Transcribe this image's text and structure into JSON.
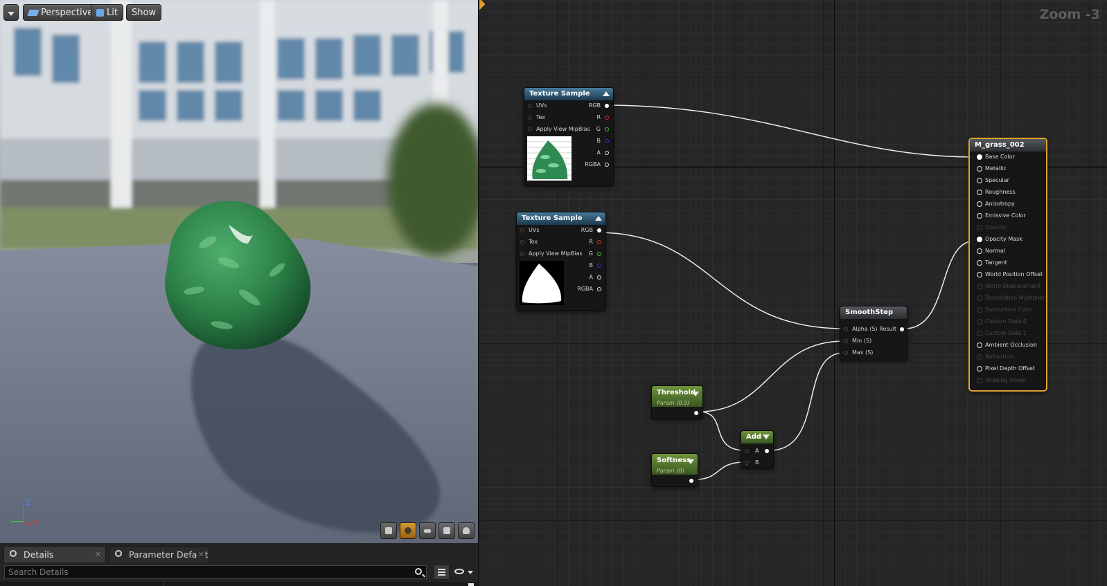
{
  "toolbar": {
    "perspective_label": "Perspective",
    "lit_label": "Lit",
    "show_label": "Show"
  },
  "gizmo": {
    "z": "Z",
    "x": "X"
  },
  "bottom_panel": {
    "tabs": [
      {
        "label": "Details"
      },
      {
        "label": "Parameter Defaults"
      }
    ],
    "search_placeholder": "Search Details"
  },
  "graph": {
    "zoom_label": "Zoom -3",
    "nodes": {
      "texture_sample_1": {
        "title": "Texture Sample",
        "inputs": [
          "UVs",
          "Tex",
          "Apply View MipBias"
        ],
        "outputs": [
          "RGB",
          "R",
          "G",
          "B",
          "A",
          "RGBA"
        ]
      },
      "texture_sample_2": {
        "title": "Texture Sample",
        "inputs": [
          "UVs",
          "Tex",
          "Apply View MipBias"
        ],
        "outputs": [
          "RGB",
          "R",
          "G",
          "B",
          "A",
          "RGBA"
        ]
      },
      "smoothstep": {
        "title": "SmoothStep",
        "inputs": [
          "Alpha (S)",
          "Min (S)",
          "Max (S)"
        ],
        "output": "Result"
      },
      "threshold": {
        "title": "Threshold",
        "subtitle": "Param (0.5)"
      },
      "softness": {
        "title": "Softness",
        "subtitle": "Param (0)"
      },
      "add": {
        "title": "Add",
        "inputs": [
          "A",
          "B"
        ]
      },
      "material": {
        "title": "M_grass_002",
        "pins": [
          {
            "label": "Base Color",
            "active": true
          },
          {
            "label": "Metallic",
            "active": true
          },
          {
            "label": "Specular",
            "active": true
          },
          {
            "label": "Roughness",
            "active": true
          },
          {
            "label": "Anisotropy",
            "active": true
          },
          {
            "label": "Emissive Color",
            "active": true
          },
          {
            "label": "Opacity",
            "active": false
          },
          {
            "label": "Opacity Mask",
            "active": true
          },
          {
            "label": "Normal",
            "active": true
          },
          {
            "label": "Tangent",
            "active": true
          },
          {
            "label": "World Position Offset",
            "active": true
          },
          {
            "label": "World Displacement",
            "active": false
          },
          {
            "label": "Tessellation Multiplier",
            "active": false
          },
          {
            "label": "Subsurface Color",
            "active": false
          },
          {
            "label": "Custom Data 0",
            "active": false
          },
          {
            "label": "Custom Data 1",
            "active": false
          },
          {
            "label": "Ambient Occlusion",
            "active": true
          },
          {
            "label": "Refraction",
            "active": false
          },
          {
            "label": "Pixel Depth Offset",
            "active": true
          },
          {
            "label": "Shading Model",
            "active": false
          }
        ]
      }
    }
  }
}
